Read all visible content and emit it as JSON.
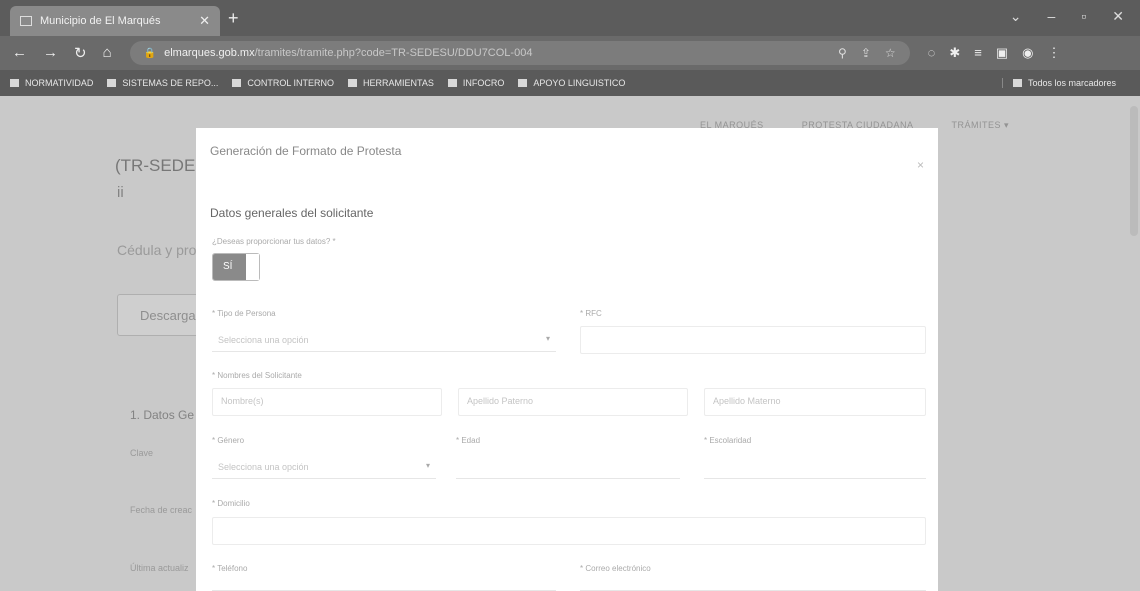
{
  "browser": {
    "tab_title": "Municipio de El Marqués",
    "tab_close": "✕",
    "new_tab": "+",
    "url_domain": "elmarques.gob.mx",
    "url_path": "/tramites/tramite.php?code=TR-SEDESU/DDU7COL-004",
    "bookmarks": [
      "NORMATIVIDAD",
      "SISTEMAS DE REPO...",
      "CONTROL INTERNO",
      "HERRAMIENTAS",
      "INFOCRO",
      "APOYO LINGUISTICO"
    ],
    "bookmarks_all": "Todos los marcadores"
  },
  "page": {
    "nav": [
      "EL MARQUÉS",
      "PROTESTA CIUDADANA",
      "TRÁMITES ▾"
    ],
    "code_fragment": "(TR-SEDESI",
    "code_fragment2": "ii",
    "cedula_fragment": "Cédula y pro",
    "button_fragment": "Descarga",
    "section_fragment": "1. Datos Ge",
    "label_1": "Clave",
    "label_2": "Fecha de creac",
    "label_3": "Última actualiz"
  },
  "modal": {
    "title": "Generación de Formato de Protesta",
    "close": "×",
    "section_title": "Datos generales del solicitante",
    "question": "¿Deseas proporcionar tus datos? *",
    "toggle_label": "SÍ",
    "tipo_persona": {
      "label": "* Tipo de Persona",
      "placeholder": "Selecciona una opción"
    },
    "rfc": {
      "label": "* RFC",
      "placeholder": ""
    },
    "nombres": {
      "label": "* Nombres del Solicitante",
      "nombre": "Nombre(s)",
      "apellido_paterno": "Apellido Paterno",
      "apellido_materno": "Apellido Materno"
    },
    "genero": {
      "label": "* Género",
      "placeholder": "Selecciona una opción"
    },
    "edad": {
      "label": "* Edad"
    },
    "escolaridad": {
      "label": "* Escolaridad"
    },
    "domicilio": {
      "label": "* Domicilio"
    },
    "telefono": {
      "label": "* Teléfono"
    },
    "correo": {
      "label": "* Correo electrónico"
    }
  }
}
